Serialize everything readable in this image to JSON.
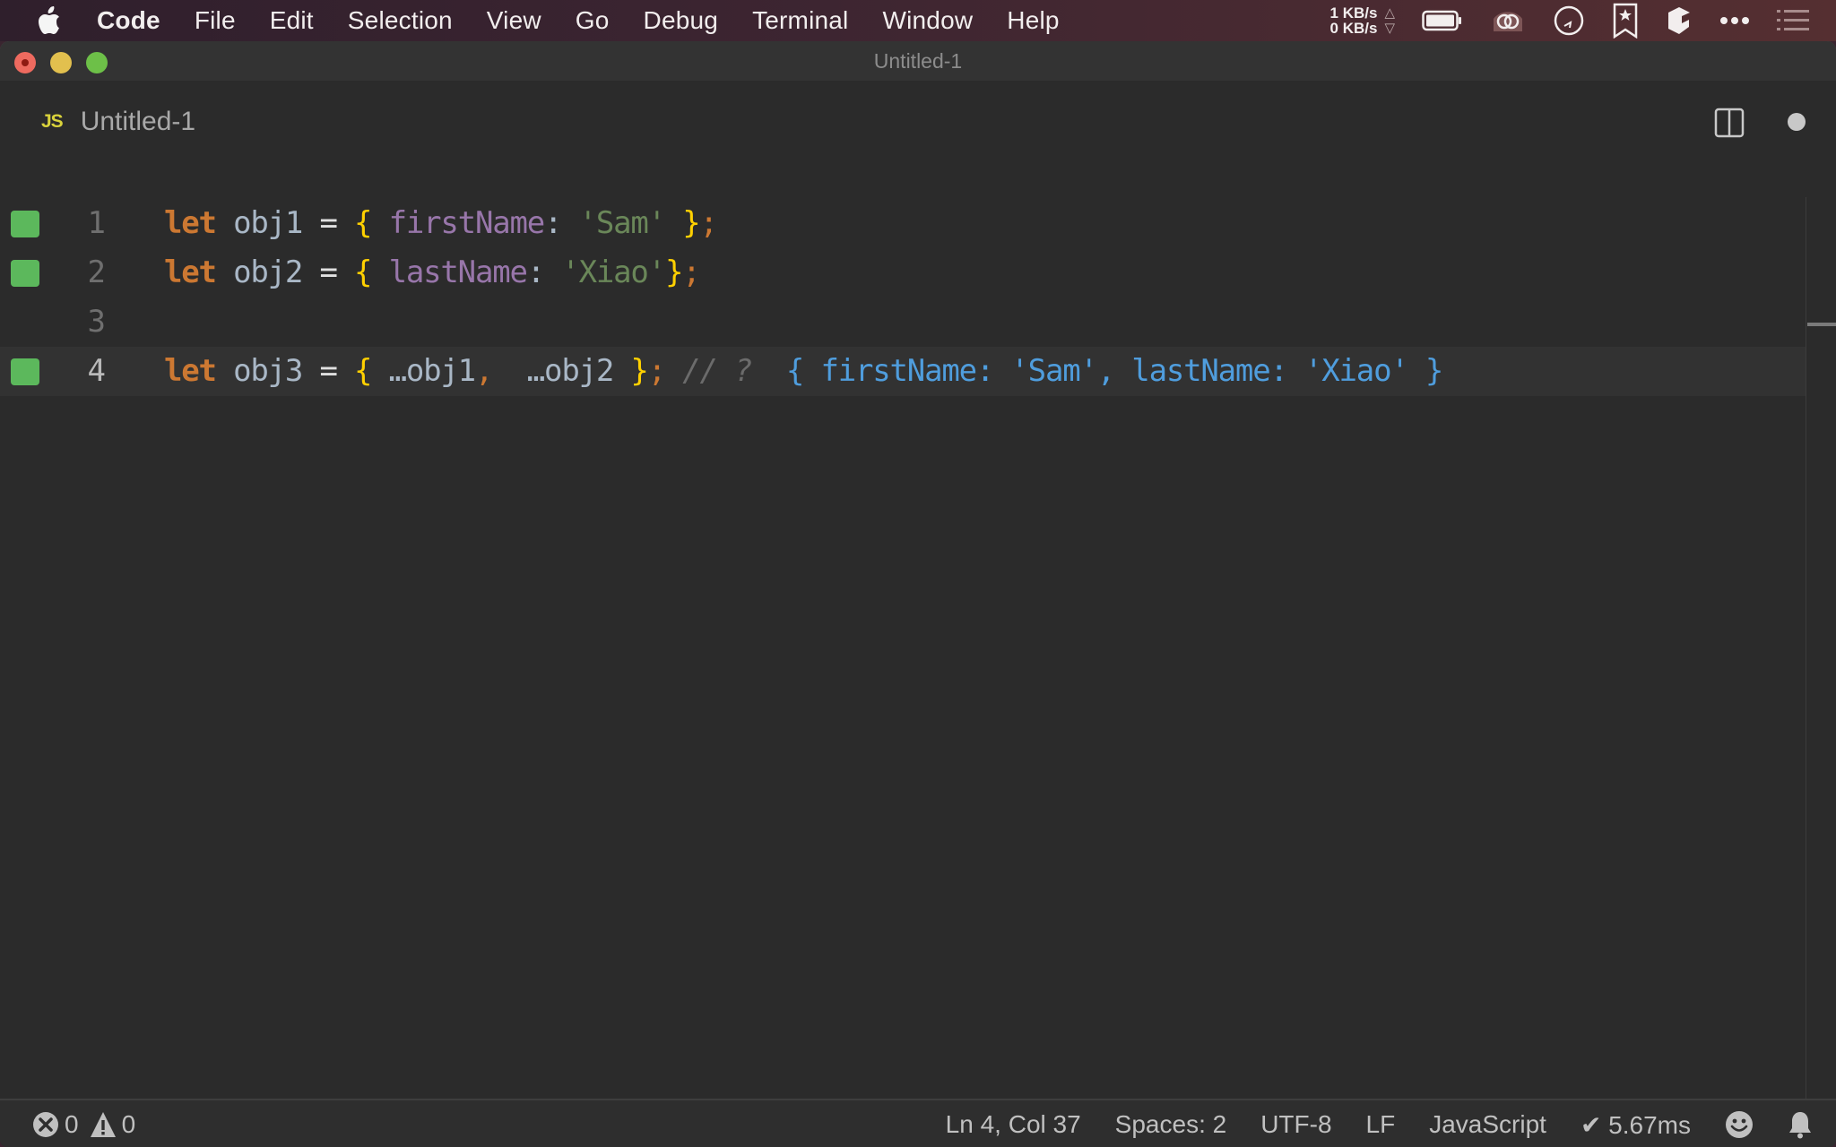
{
  "menubar": {
    "apple_icon": "apple-logo-icon",
    "items": [
      "Code",
      "File",
      "Edit",
      "Selection",
      "View",
      "Go",
      "Debug",
      "Terminal",
      "Window",
      "Help"
    ],
    "net_upload": "1 KB/s",
    "net_download": "0 KB/s",
    "net_up_arrow": "△",
    "net_down_arrow": "▽",
    "tray_icons": [
      "battery-icon",
      "creative-cloud-icon",
      "clock-icon",
      "bookmark-star-icon",
      "dropbox-like-icon",
      "more-icon",
      "list-icon"
    ]
  },
  "window": {
    "title": "Untitled-1",
    "traffic_lights": [
      "close",
      "minimize",
      "maximize"
    ]
  },
  "tab": {
    "language_badge": "JS",
    "label": "Untitled-1",
    "dirty": true
  },
  "editor": {
    "lines": [
      {
        "number": "1",
        "coverage": true,
        "tokens": [
          {
            "t": "let",
            "c": "kw"
          },
          {
            "t": " ",
            "c": "ident"
          },
          {
            "t": "obj1",
            "c": "ident"
          },
          {
            "t": " ",
            "c": "ident"
          },
          {
            "t": "=",
            "c": "op"
          },
          {
            "t": " ",
            "c": "ident"
          },
          {
            "t": "{",
            "c": "brace"
          },
          {
            "t": " ",
            "c": "ident"
          },
          {
            "t": "firstName",
            "c": "prop"
          },
          {
            "t": ": ",
            "c": "colon"
          },
          {
            "t": "'Sam'",
            "c": "str"
          },
          {
            "t": " ",
            "c": "ident"
          },
          {
            "t": "}",
            "c": "brace"
          },
          {
            "t": ";",
            "c": "punc"
          }
        ]
      },
      {
        "number": "2",
        "coverage": true,
        "tokens": [
          {
            "t": "let",
            "c": "kw"
          },
          {
            "t": " ",
            "c": "ident"
          },
          {
            "t": "obj2",
            "c": "ident"
          },
          {
            "t": " ",
            "c": "ident"
          },
          {
            "t": "=",
            "c": "op"
          },
          {
            "t": " ",
            "c": "ident"
          },
          {
            "t": "{",
            "c": "brace"
          },
          {
            "t": " ",
            "c": "ident"
          },
          {
            "t": "lastName",
            "c": "prop"
          },
          {
            "t": ": ",
            "c": "colon"
          },
          {
            "t": "'Xiao'",
            "c": "str"
          },
          {
            "t": "}",
            "c": "brace"
          },
          {
            "t": ";",
            "c": "punc"
          }
        ]
      },
      {
        "number": "3",
        "coverage": false,
        "tokens": []
      },
      {
        "number": "4",
        "coverage": true,
        "current": true,
        "tokens": [
          {
            "t": "let",
            "c": "kw"
          },
          {
            "t": " ",
            "c": "ident"
          },
          {
            "t": "obj3",
            "c": "ident"
          },
          {
            "t": " ",
            "c": "ident"
          },
          {
            "t": "=",
            "c": "op"
          },
          {
            "t": " ",
            "c": "ident"
          },
          {
            "t": "{",
            "c": "brace"
          },
          {
            "t": " …",
            "c": "ident"
          },
          {
            "t": "obj1",
            "c": "ident"
          },
          {
            "t": ",",
            "c": "punc"
          },
          {
            "t": "  …",
            "c": "ident"
          },
          {
            "t": "obj2",
            "c": "ident"
          },
          {
            "t": " ",
            "c": "ident"
          },
          {
            "t": "}",
            "c": "brace"
          },
          {
            "t": ";",
            "c": "punc"
          },
          {
            "t": " ",
            "c": "ident"
          },
          {
            "t": "// ?",
            "c": "cmt"
          },
          {
            "t": "  ",
            "c": "ident"
          },
          {
            "t": "{ firstName: 'Sam', lastName: 'Xiao' }",
            "c": "result"
          }
        ]
      }
    ]
  },
  "statusbar": {
    "errors": "0",
    "warnings": "0",
    "cursor": "Ln 4, Col 37",
    "indent": "Spaces: 2",
    "encoding": "UTF-8",
    "eol": "LF",
    "language": "JavaScript",
    "timing": "✔ 5.67ms"
  },
  "colors": {
    "keyword": "#cc7832",
    "brace": "#ffd000",
    "property": "#9876aa",
    "string": "#6a8759",
    "identifier": "#a9b7c6",
    "comment": "#6b6b6b",
    "inline_result": "#4f9ddd",
    "coverage_marker": "#5cb85c",
    "editor_bg": "#2b2b2b"
  }
}
